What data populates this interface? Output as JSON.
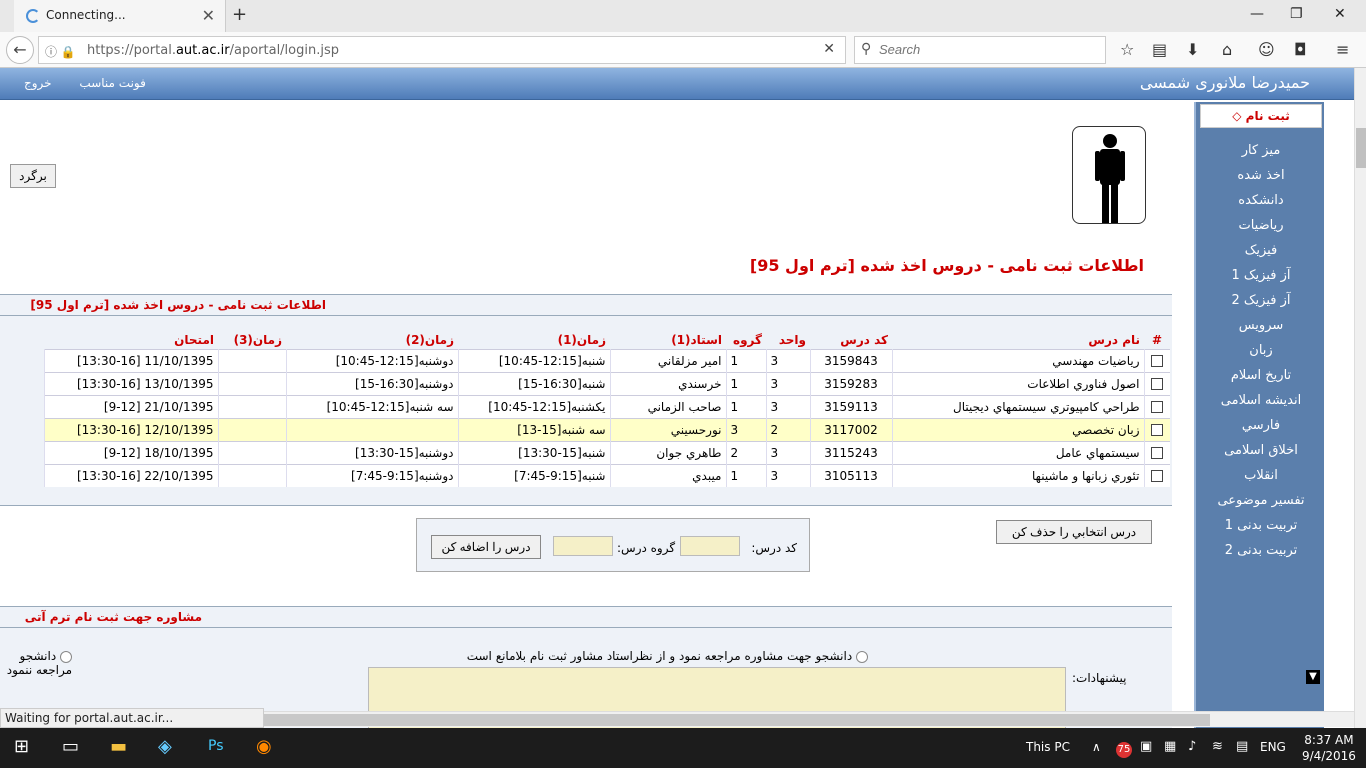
{
  "browser": {
    "tab_title": "Connecting...",
    "url_prefix": "https://portal.",
    "url_domain": "aut.ac.ir",
    "url_path": "/aportal/login.jsp",
    "search_placeholder": "Search",
    "status_text": "Waiting for portal.aut.ac.ir..."
  },
  "header": {
    "user_name": "حمیدرضا ملانوری شمسی",
    "link_font": "فونت مناسب",
    "link_exit": "خروج"
  },
  "sidebar": {
    "title": "ثبت نام",
    "items": [
      "میز کار",
      "اخذ شده",
      "دانشکده",
      "ریاضیات",
      "فیزیک",
      "آز فیزیک 1",
      "آز فیزیک 2",
      "سرویس",
      "زبان",
      "تاریخ اسلام",
      "اندیشه اسلامی",
      "فارسي",
      "اخلاق اسلامی",
      "انقلاب",
      "تفسیر موضوعی",
      "تربیت بدنی 1",
      "تربیت بدنی 2"
    ]
  },
  "content": {
    "back_button": "برگرد",
    "big_title": "اطلاعات ثبت نامی - دروس اخذ شده [ترم اول 95]",
    "section1_title": "اطلاعات ثبت نامی - دروس اخذ شده [ترم اول 95]",
    "columns": [
      "#",
      "نام درس",
      "کد درس",
      "واحد",
      "گروه",
      "استاد(1)",
      "زمان(1)",
      "زمان(2)",
      "زمان(3)",
      "امتحان"
    ],
    "rows": [
      {
        "name": "رياضيات مهندسي",
        "code": "3159843",
        "units": "3",
        "group": "1",
        "teacher": "امير مزلقاني",
        "time1": "شنبه[12:15-10:45]",
        "time2": "دوشنبه[12:15-10:45]",
        "time3": "",
        "exam": "11/10/1395 [13:30-16]"
      },
      {
        "name": "اصول فناوري اطلاعات",
        "code": "3159283",
        "units": "3",
        "group": "1",
        "teacher": "خرسندي",
        "time1": "شنبه[16:30-15]",
        "time2": "دوشنبه[16:30-15]",
        "time3": "",
        "exam": "13/10/1395 [13:30-16]"
      },
      {
        "name": "طراحي كامپيوتري سيستمهاي ديجيتال",
        "code": "3159113",
        "units": "3",
        "group": "1",
        "teacher": "صاحب الزماني",
        "time1": "يكشنبه[12:15-10:45]",
        "time2": "سه شنبه[12:15-10:45]",
        "time3": "",
        "exam": "21/10/1395 [9-12]"
      },
      {
        "name": "زبان تخصصي",
        "code": "3117002",
        "units": "2",
        "group": "3",
        "teacher": "نورحسيني",
        "time1": "سه شنبه[15-13]",
        "time2": "",
        "time3": "",
        "exam": "12/10/1395 [13:30-16]",
        "highlight": true
      },
      {
        "name": "سيستمهاي عامل",
        "code": "3115243",
        "units": "3",
        "group": "2",
        "teacher": "طاهري جوان",
        "time1": "شنبه[15-13:30]",
        "time2": "دوشنبه[15-13:30]",
        "time3": "",
        "exam": "18/10/1395 [9-12]"
      },
      {
        "name": "تئوري زبانها و ماشينها",
        "code": "3105113",
        "units": "3",
        "group": "1",
        "teacher": "ميبدي",
        "time1": "شنبه[9:15-7:45]",
        "time2": "دوشنبه[9:15-7:45]",
        "time3": "",
        "exam": "22/10/1395 [13:30-16]"
      }
    ],
    "delete_button": "درس انتخابي را حذف كن",
    "add_button": "درس را اضافه كن",
    "code_label": "كد درس:",
    "group_label": "گروه درس:",
    "section2_title": "مشاوره جهت ثبت نام ترم آتی",
    "option1": "دانشجو جهت مشاوره مراجعه نمود و از نظراستاد مشاور ثبت نام بلامانع است",
    "option2": "دانشجو مراجعه ننمود",
    "suggestions_label": "پیشنهادات:"
  },
  "taskbar": {
    "this_pc": "This PC",
    "lang": "ENG",
    "time": "8:37 AM",
    "date": "9/4/2016",
    "badge": "75"
  }
}
